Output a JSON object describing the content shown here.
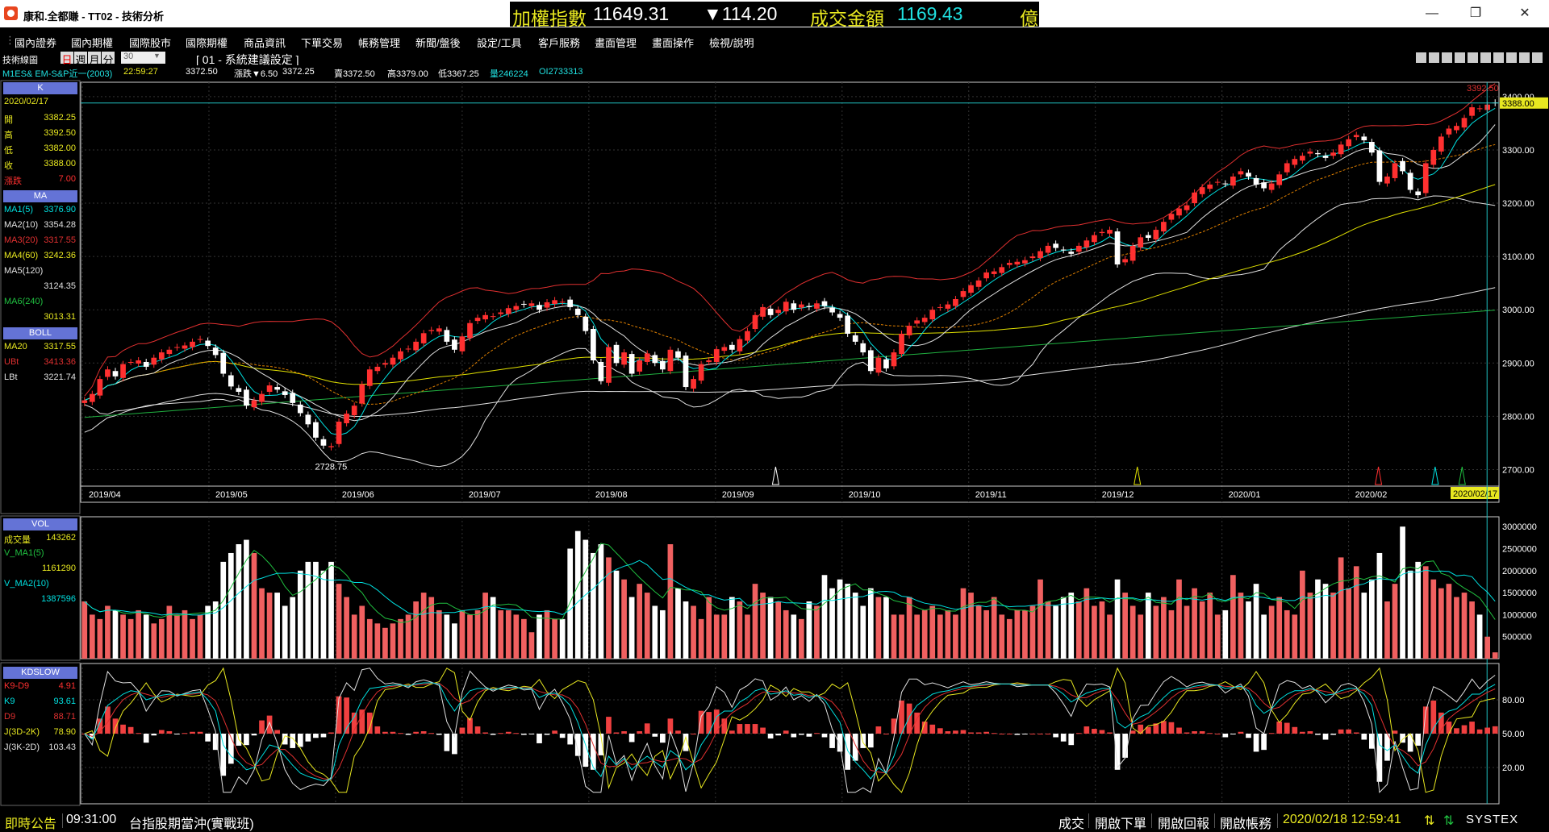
{
  "window": {
    "title": "康和.全都賺 - TT02 - 技術分析"
  },
  "ticker": {
    "label": "加權指數",
    "value": "11649.31",
    "change": "▼114.20",
    "amount_label": "成交金額",
    "amount": "1169.43",
    "unit": "億"
  },
  "menu": [
    "國內證券",
    "國內期權",
    "國際股市",
    "國際期權",
    "商品資訊",
    "下單交易",
    "帳務管理",
    "新聞/盤後",
    "設定/工具",
    "客戶服務",
    "畫面管理",
    "畫面操作",
    "檢視/說明"
  ],
  "toolbar": {
    "chart_label": "技術線圖",
    "periods": [
      "日",
      "週",
      "月",
      "分"
    ],
    "minutes": "30",
    "preset": "[ 01 - 系統建議設定 ]"
  },
  "info": {
    "symbol": "M1ES&  EM-S&P近一(2003)",
    "time": "22:59:27",
    "last": "3372.50",
    "change": "漲跌▼6.50",
    "price2": "3372.25",
    "ask": "賣3372.50",
    "high": "高3379.00",
    "low": "低3367.25",
    "volume": "量246224",
    "oi": "OI2733313"
  },
  "colors": {
    "up": "#ff3030",
    "down": "#ffffff",
    "header": "#6473d6",
    "ma1": "#00e0e0",
    "ma2": "#e08000",
    "ma3": "#e03030",
    "ma4": "#e0e000",
    "ma5": "#e0e0e0",
    "ma6": "#20b040",
    "boll": "#e03030"
  },
  "panel": {
    "k": {
      "header": "K",
      "date": "2020/02/17",
      "rows": [
        {
          "label": "開",
          "value": "3382.25"
        },
        {
          "label": "高",
          "value": "3392.50"
        },
        {
          "label": "低",
          "value": "3382.00"
        },
        {
          "label": "收",
          "value": "3388.00"
        },
        {
          "label": "漲跌",
          "value": "7.00"
        }
      ]
    },
    "ma": {
      "header": "MA",
      "rows": [
        {
          "label": "MA1(5)",
          "value": "3376.90"
        },
        {
          "label": "MA2(10)",
          "value": "3354.28"
        },
        {
          "label": "MA3(20)",
          "value": "3317.55"
        },
        {
          "label": "MA4(60)",
          "value": "3242.36"
        },
        {
          "label": "MA5(120)",
          "value": "3124.35"
        },
        {
          "label": "MA6(240)",
          "value": "3013.31"
        }
      ]
    },
    "boll": {
      "header": "BOLL",
      "rows": [
        {
          "label": "MA20",
          "value": "3317.55"
        },
        {
          "label": "UBt",
          "value": "3413.36"
        },
        {
          "label": "LBt",
          "value": "3221.74"
        }
      ]
    },
    "vol": {
      "header": "VOL",
      "rows": [
        {
          "label": "成交量",
          "value": "143262"
        },
        {
          "label": "V_MA1(5)",
          "value": "1161290"
        },
        {
          "label": "V_MA2(10)",
          "value": "1387596"
        }
      ]
    },
    "kd": {
      "header": "KDSLOW",
      "rows": [
        {
          "label": "K9-D9",
          "value": "4.91"
        },
        {
          "label": "K9",
          "value": "93.61"
        },
        {
          "label": "D9",
          "value": "88.71"
        },
        {
          "label": "J(3D-2K)",
          "value": "78.90"
        },
        {
          "label": "J(3K-2D)",
          "value": "103.43"
        }
      ]
    }
  },
  "chart_data": {
    "type": "candlestick",
    "months": [
      "2019/04",
      "2019/05",
      "2019/06",
      "2019/07",
      "2019/08",
      "2019/09",
      "2019/10",
      "2019/11",
      "2019/12",
      "2020/01",
      "2020/02"
    ],
    "last_date": "2020/02/17",
    "price_ticks": [
      "3400.00",
      "3300.00",
      "3200.00",
      "3100.00",
      "3000.00",
      "2900.00",
      "2800.00",
      "2700.00"
    ],
    "price_range": [
      2672,
      3427
    ],
    "last_price": "3388.00",
    "high_label": "3392.50",
    "low_label": "2728.75",
    "volume_ticks": [
      "3000000",
      "2500000",
      "2000000",
      "1500000",
      "1000000",
      "500000"
    ],
    "kd_ticks": [
      "80.00",
      "50.00",
      "20.00"
    ],
    "closes": [
      2830,
      2842,
      2870,
      2888,
      2875,
      2898,
      2902,
      2905,
      2893,
      2910,
      2920,
      2925,
      2930,
      2933,
      2940,
      2945,
      2932,
      2915,
      2880,
      2856,
      2846,
      2820,
      2830,
      2842,
      2858,
      2850,
      2840,
      2825,
      2806,
      2785,
      2760,
      2745,
      2744,
      2790,
      2805,
      2820,
      2860,
      2888,
      2893,
      2900,
      2910,
      2922,
      2927,
      2940,
      2956,
      2962,
      2965,
      2940,
      2925,
      2950,
      2975,
      2985,
      2990,
      2988,
      2995,
      3003,
      3007,
      3010,
      3012,
      3000,
      3014,
      3018,
      3015,
      3005,
      2990,
      2960,
      2905,
      2866,
      2930,
      2900,
      2920,
      2880,
      2905,
      2918,
      2900,
      2888,
      2925,
      2910,
      2855,
      2870,
      2898,
      2905,
      2926,
      2930,
      2925,
      2945,
      2960,
      2990,
      3005,
      2990,
      3000,
      3015,
      3000,
      3010,
      3005,
      3012,
      3007,
      2995,
      2985,
      2955,
      2940,
      2920,
      2885,
      2910,
      2890,
      2920,
      2955,
      2970,
      2980,
      2985,
      3000,
      3005,
      3010,
      3020,
      3035,
      3046,
      3055,
      3070,
      3072,
      3080,
      3088,
      3090,
      3093,
      3100,
      3110,
      3120,
      3116,
      3112,
      3105,
      3120,
      3130,
      3140,
      3146,
      3150,
      3085,
      3095,
      3120,
      3136,
      3135,
      3150,
      3165,
      3180,
      3190,
      3196,
      3220,
      3230,
      3235,
      3240,
      3236,
      3250,
      3260,
      3250,
      3235,
      3228,
      3237,
      3254,
      3275,
      3283,
      3289,
      3297,
      3292,
      3285,
      3295,
      3310,
      3320,
      3328,
      3318,
      3295,
      3240,
      3250,
      3275,
      3260,
      3225,
      3215,
      3275,
      3300,
      3325,
      3340,
      3345,
      3360,
      3380,
      3378,
      3385,
      3388
    ],
    "volumes": [
      1300000,
      1000000,
      900000,
      1200000,
      1100000,
      1000000,
      900000,
      1100000,
      1000000,
      800000,
      900000,
      1200000,
      1000000,
      1100000,
      900000,
      1000000,
      1200000,
      1300000,
      2200000,
      2400000,
      2600000,
      2700000,
      2400000,
      1600000,
      1500000,
      1500000,
      1200000,
      1400000,
      2000000,
      2200000,
      2200000,
      2000000,
      2200000,
      1700000,
      1400000,
      1000000,
      1200000,
      900000,
      800000,
      700000,
      800000,
      900000,
      1000000,
      1300000,
      1500000,
      1400000,
      1100000,
      1000000,
      800000,
      1100000,
      1000000,
      1100000,
      1500000,
      1400000,
      1100000,
      1100000,
      1000000,
      900000,
      600000,
      1000000,
      1100000,
      900000,
      900000,
      2500000,
      2900000,
      2700000,
      2400000,
      2600000,
      2300000,
      2000000,
      1800000,
      1400000,
      1700000,
      1500000,
      1200000,
      1100000,
      2600000,
      1600000,
      1300000,
      1200000,
      900000,
      1400000,
      1000000,
      1000000,
      1400000,
      1300000,
      1000000,
      1700000,
      1500000,
      1400000,
      1300000,
      1100000,
      1000000,
      900000,
      1300000,
      1200000,
      1900000,
      1600000,
      1800000,
      1700000,
      1500000,
      1200000,
      1600000,
      1400000,
      1400000,
      1000000,
      1000000,
      1400000,
      1000000,
      1100000,
      1200000,
      1000000,
      1100000,
      1000000,
      1600000,
      1500000,
      1200000,
      1100000,
      1400000,
      1000000,
      900000,
      1100000,
      1100000,
      1200000,
      1800000,
      1300000,
      1200000,
      1400000,
      1500000,
      1300000,
      1600000,
      1200000,
      1300000,
      1000000,
      1800000,
      1500000,
      1200000,
      1000000,
      1500000,
      1200000,
      1400000,
      1100000,
      1800000,
      1200000,
      1600000,
      1300000,
      1500000,
      1000000,
      1100000,
      1900000,
      1500000,
      1300000,
      1700000,
      1000000,
      1200000,
      1400000,
      1100000,
      1000000,
      2000000,
      1500000,
      1800000,
      1700000,
      1500000,
      2300000,
      1600000,
      2100000,
      1500000,
      1800000,
      2400000,
      1300000,
      1700000,
      3000000,
      2000000,
      2200000,
      2100000,
      1800000,
      1600000,
      1700000,
      1400000,
      1500000,
      1300000,
      1000000,
      500000,
      143262
    ],
    "kd_k": [
      50,
      45,
      60,
      75,
      80,
      85,
      88,
      87,
      80,
      82,
      84,
      85,
      84,
      85,
      86,
      87,
      80,
      70,
      40,
      30,
      25,
      18,
      20,
      30,
      40,
      38,
      30,
      22,
      15,
      12,
      10,
      8,
      10,
      40,
      55,
      65,
      80,
      90,
      91,
      92,
      93,
      93,
      92,
      94,
      95,
      95,
      94,
      80,
      70,
      80,
      88,
      90,
      90,
      89,
      90,
      91,
      91,
      90,
      90,
      82,
      85,
      86,
      82,
      75,
      60,
      40,
      20,
      12,
      30,
      22,
      28,
      18,
      25,
      30,
      25,
      20,
      35,
      30,
      18,
      24,
      40,
      50,
      65,
      70,
      70,
      78,
      82,
      88,
      90,
      85,
      86,
      88,
      84,
      85,
      82,
      84,
      80,
      70,
      60,
      35,
      25,
      18,
      10,
      20,
      15,
      30,
      50,
      65,
      75,
      80,
      85,
      87,
      88,
      90,
      92,
      92,
      93,
      94,
      94,
      94,
      94,
      93,
      93,
      93,
      93,
      93,
      90,
      85,
      78,
      82,
      86,
      88,
      90,
      90,
      60,
      55,
      60,
      65,
      68,
      75,
      82,
      88,
      90,
      90,
      92,
      93,
      93,
      93,
      90,
      91,
      92,
      88,
      75,
      68,
      72,
      80,
      85,
      88,
      88,
      90,
      88,
      84,
      85,
      88,
      90,
      90,
      85,
      75,
      40,
      35,
      40,
      30,
      20,
      15,
      40,
      55,
      65,
      70,
      72,
      78,
      85,
      85,
      90,
      93.61
    ],
    "markers": [
      {
        "month_pos": 0.49,
        "color": "#ffffff"
      },
      {
        "month_pos": 0.745,
        "color": "#e0e000"
      },
      {
        "month_pos": 0.915,
        "color": "#ff3030"
      },
      {
        "month_pos": 0.955,
        "color": "#00e0e0"
      },
      {
        "month_pos": 0.974,
        "color": "#20c040"
      }
    ]
  },
  "status": {
    "notice": "即時公告",
    "time": "09:31:00",
    "message": "台指股期當沖(實戰班)",
    "items": [
      "成交",
      "開啟下單",
      "開啟回報",
      "開啟帳務"
    ],
    "datetime": "2020/02/18 12:59:41",
    "brand": "SYSTEX"
  }
}
